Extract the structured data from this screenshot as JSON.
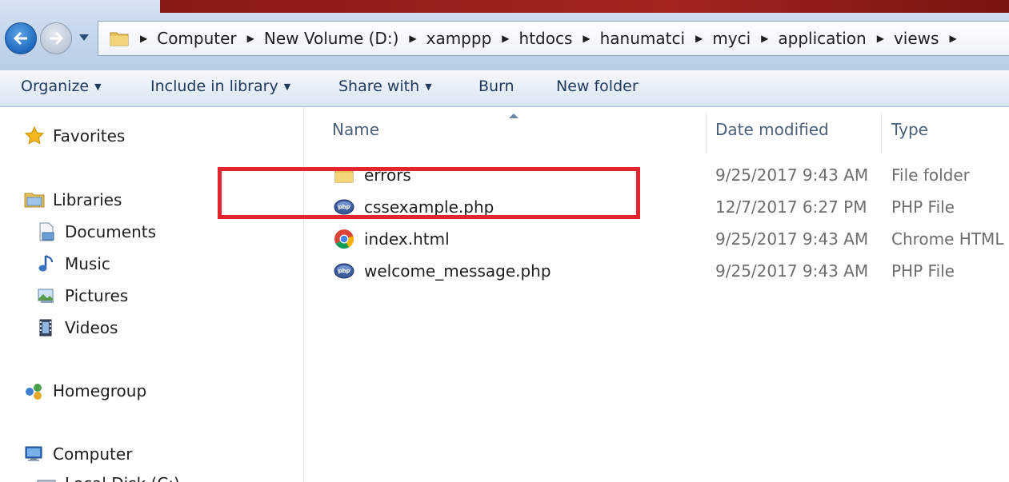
{
  "address_bar": {
    "breadcrumbs": [
      "Computer",
      "New Volume (D:)",
      "xamppp",
      "htdocs",
      "hanumatci",
      "myci",
      "application",
      "views"
    ]
  },
  "toolbar": {
    "organize": "Organize",
    "include_in_library": "Include in library",
    "share_with": "Share with",
    "burn": "Burn",
    "new_folder": "New folder"
  },
  "nav_pane": {
    "favorites": "Favorites",
    "libraries": "Libraries",
    "documents": "Documents",
    "music": "Music",
    "pictures": "Pictures",
    "videos": "Videos",
    "homegroup": "Homegroup",
    "computer": "Computer",
    "local_disk": "Local Disk (C:)"
  },
  "file_list": {
    "columns": {
      "name": "Name",
      "date_modified": "Date modified",
      "type": "Type"
    },
    "rows": [
      {
        "name": "errors",
        "date": "9/25/2017 9:43 AM",
        "type": "File folder",
        "icon": "folder-icon"
      },
      {
        "name": "cssexample.php",
        "date": "12/7/2017 6:27 PM",
        "type": "PHP File",
        "icon": "php-file-icon"
      },
      {
        "name": "index.html",
        "date": "9/25/2017 9:43 AM",
        "type": "Chrome HTML",
        "icon": "chrome-icon"
      },
      {
        "name": "welcome_message.php",
        "date": "9/25/2017 9:43 AM",
        "type": "PHP File",
        "icon": "php-file-icon"
      }
    ]
  },
  "colors": {
    "highlight_box": "#e3262e",
    "toolbar_text": "#1e395b",
    "secondary_text": "#6d6d6d"
  }
}
